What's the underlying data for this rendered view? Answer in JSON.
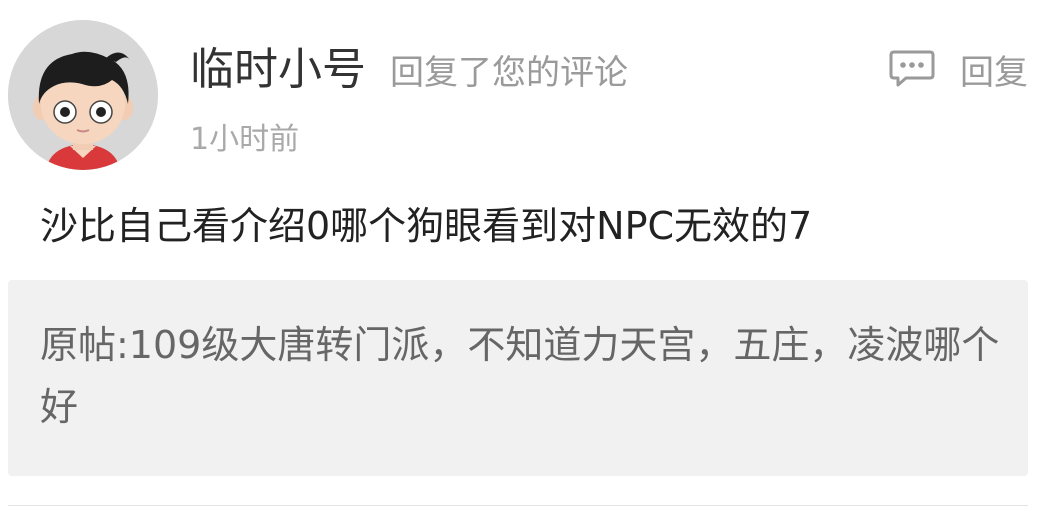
{
  "comment": {
    "username": "临时小号",
    "action_text": "回复了您的评论",
    "timestamp": "1小时前",
    "reply_label": "回复",
    "reply_icon": "comment-bubble-icon",
    "body": "沙比自己看介绍0哪个狗眼看到对NPC无效的7",
    "quoted_post": "原帖:109级大唐转门派，不知道力天宫，五庄，凌波哪个好"
  },
  "colors": {
    "username": "#333333",
    "secondary_text": "#9a9a9a",
    "body_text": "#222222",
    "quote_bg": "#f1f1f1",
    "quote_text": "#666666",
    "avatar_bg": "#d7d7d7"
  }
}
